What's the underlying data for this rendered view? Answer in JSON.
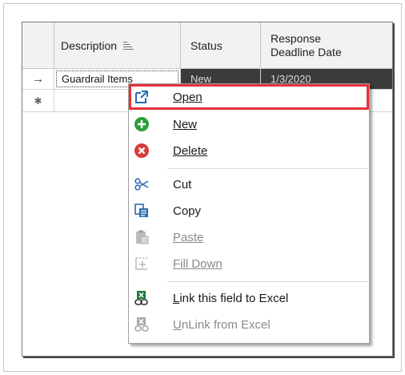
{
  "grid": {
    "columns": [
      "Description",
      "Status",
      "Response Deadline Date"
    ],
    "row_indicator": "→",
    "new_row_indicator": "✱",
    "rows": [
      {
        "description": "Guardrail Items",
        "status": "New",
        "deadline": "1/3/2020"
      }
    ]
  },
  "context_menu": {
    "items": [
      {
        "label": "Open",
        "icon": "open-external-icon",
        "highlighted": true,
        "enabled": true
      },
      {
        "label": "New",
        "icon": "plus-circle-icon",
        "enabled": true
      },
      {
        "label": "Delete",
        "icon": "delete-x-circle-icon",
        "enabled": true
      },
      {
        "label": "Cut",
        "icon": "scissors-icon",
        "enabled": true
      },
      {
        "label": "Copy",
        "icon": "copy-icon",
        "enabled": true
      },
      {
        "label": "Paste",
        "icon": "paste-icon",
        "enabled": false
      },
      {
        "label": "Fill Down",
        "icon": "fill-down-icon",
        "enabled": false
      },
      {
        "label": "Link this field to Excel",
        "icon": "excel-link-icon",
        "enabled": true
      },
      {
        "label": "UnLink from Excel",
        "icon": "excel-unlink-icon",
        "enabled": false
      }
    ],
    "highlight_color": "#e53238"
  }
}
